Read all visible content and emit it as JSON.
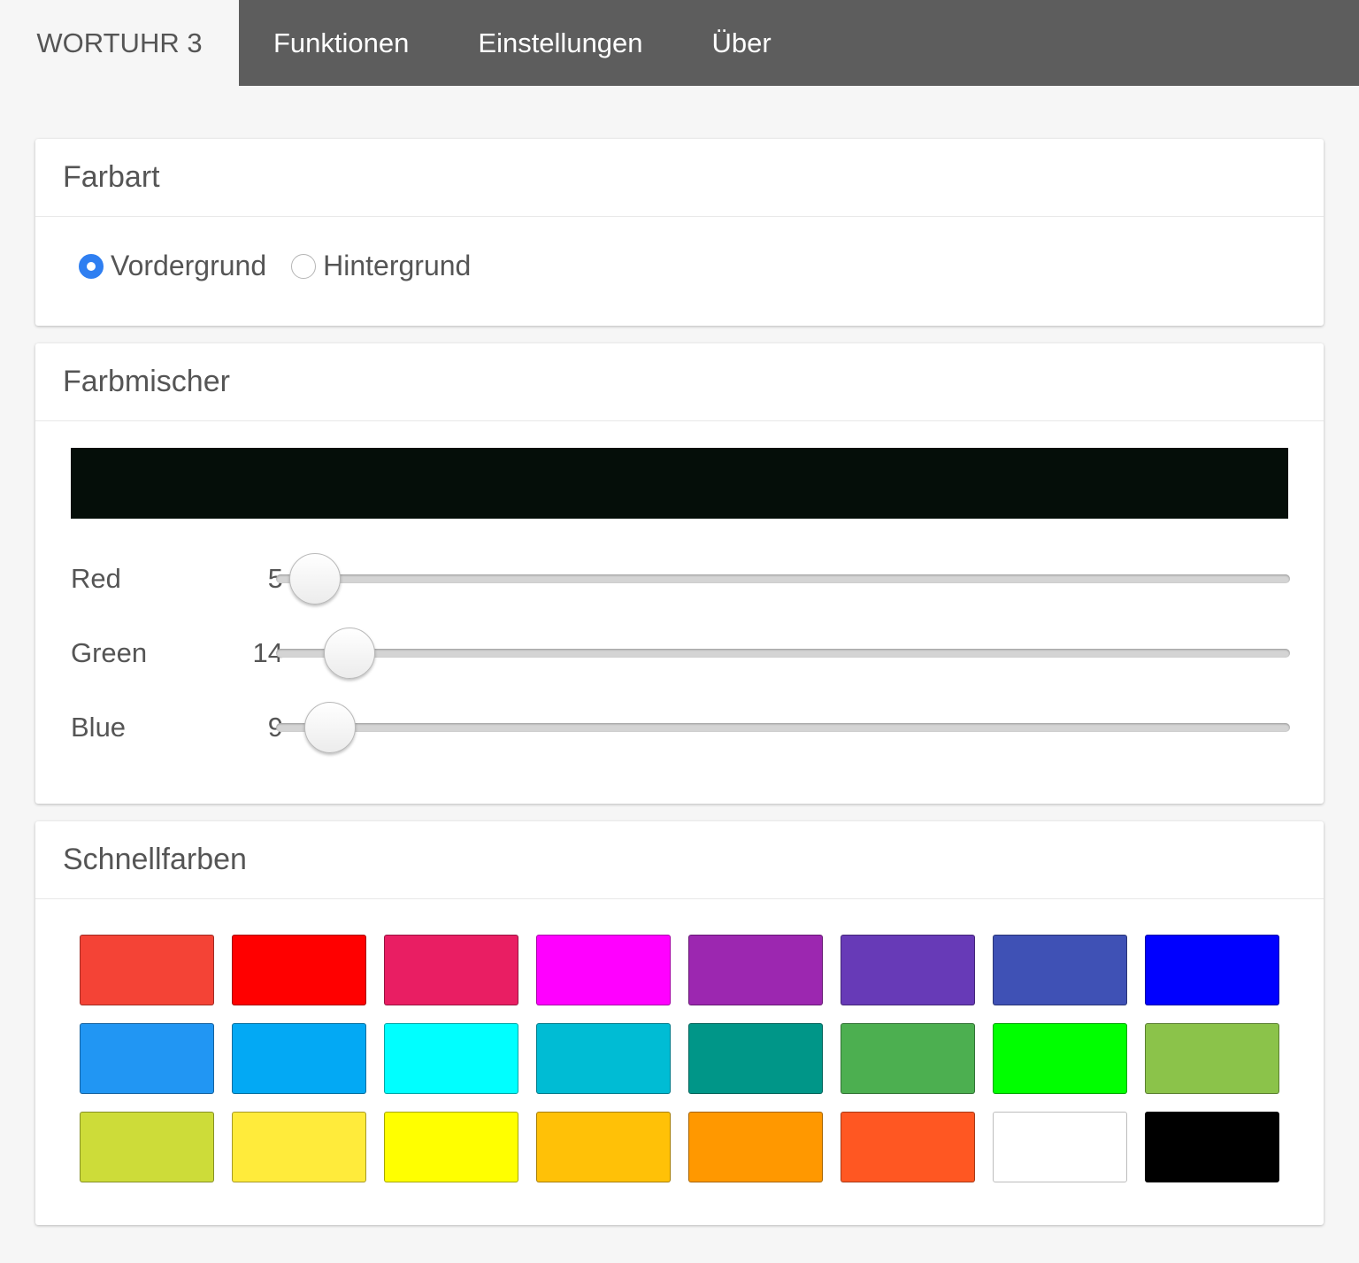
{
  "nav": {
    "brand": "WORTUHR 3",
    "items": [
      "Funktionen",
      "Einstellungen",
      "Über"
    ]
  },
  "farbart": {
    "title": "Farbart",
    "options": [
      {
        "label": "Vordergrund",
        "checked": true
      },
      {
        "label": "Hintergrund",
        "checked": false
      }
    ]
  },
  "farbmischer": {
    "title": "Farbmischer",
    "preview_color": "#050e09",
    "sliders": [
      {
        "label": "Red",
        "value": 5,
        "max": 255
      },
      {
        "label": "Green",
        "value": 14,
        "max": 255
      },
      {
        "label": "Blue",
        "value": 9,
        "max": 255
      }
    ]
  },
  "schnellfarben": {
    "title": "Schnellfarben",
    "colors": [
      "#f44336",
      "#ff0000",
      "#e91e63",
      "#ff00ff",
      "#9c27b0",
      "#673ab7",
      "#3f51b5",
      "#0000ff",
      "#2196f3",
      "#03a9f4",
      "#00ffff",
      "#00bcd4",
      "#009688",
      "#4caf50",
      "#00ff00",
      "#8bc34a",
      "#cddc39",
      "#ffeb3b",
      "#ffff00",
      "#ffc107",
      "#ff9800",
      "#ff5722",
      "#ffffff",
      "#000000"
    ]
  }
}
